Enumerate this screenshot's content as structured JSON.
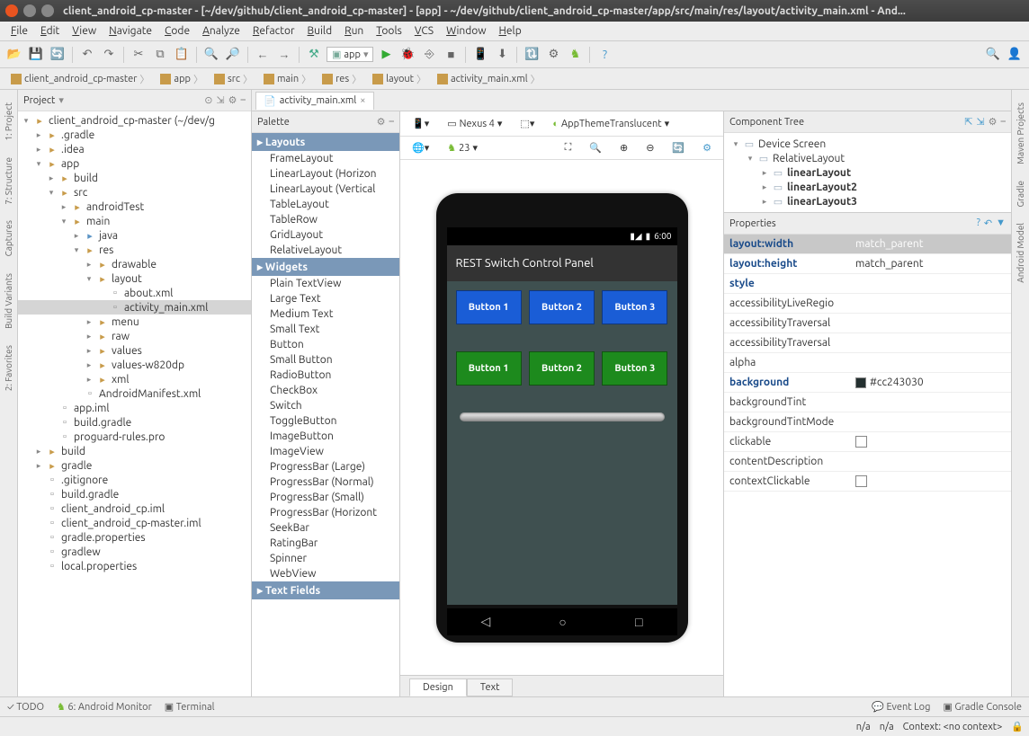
{
  "window": {
    "title": "client_android_cp-master - [~/dev/github/client_android_cp-master] - [app] - ~/dev/github/client_android_cp-master/app/src/main/res/layout/activity_main.xml - And..."
  },
  "menu": [
    "File",
    "Edit",
    "View",
    "Navigate",
    "Code",
    "Analyze",
    "Refactor",
    "Build",
    "Run",
    "Tools",
    "VCS",
    "Window",
    "Help"
  ],
  "toolbar": {
    "run_config": "app"
  },
  "breadcrumbs": [
    "client_android_cp-master",
    "app",
    "src",
    "main",
    "res",
    "layout",
    "activity_main.xml"
  ],
  "left_rail": [
    "1: Project",
    "7: Structure",
    "Captures"
  ],
  "left_rail2": [
    "Build Variants",
    "2: Favorites"
  ],
  "right_rail_top": [
    "Maven Projects",
    "Gradle"
  ],
  "right_rail_bottom": [
    "Android Model"
  ],
  "project_panel": {
    "title": "Project"
  },
  "tree": [
    {
      "d": 0,
      "a": "▾",
      "i": "folder-c",
      "t": "client_android_cp-master",
      "suffix": " (~/dev/g"
    },
    {
      "d": 1,
      "a": "▸",
      "i": "folder-c",
      "t": ".gradle"
    },
    {
      "d": 1,
      "a": "▸",
      "i": "folder-c",
      "t": ".idea"
    },
    {
      "d": 1,
      "a": "▾",
      "i": "folder-c",
      "t": "app"
    },
    {
      "d": 2,
      "a": "▸",
      "i": "folder-c",
      "t": "build"
    },
    {
      "d": 2,
      "a": "▾",
      "i": "folder-c",
      "t": "src"
    },
    {
      "d": 3,
      "a": "▸",
      "i": "folder-c",
      "t": "androidTest"
    },
    {
      "d": 3,
      "a": "▾",
      "i": "folder-c",
      "t": "main"
    },
    {
      "d": 4,
      "a": "▸",
      "i": "folder-b",
      "t": "java"
    },
    {
      "d": 4,
      "a": "▾",
      "i": "folder-c",
      "t": "res"
    },
    {
      "d": 5,
      "a": "▸",
      "i": "folder-c",
      "t": "drawable"
    },
    {
      "d": 5,
      "a": "▾",
      "i": "folder-c",
      "t": "layout"
    },
    {
      "d": 6,
      "a": "",
      "i": "file-x",
      "t": "about.xml"
    },
    {
      "d": 6,
      "a": "",
      "i": "file-x",
      "t": "activity_main.xml",
      "sel": true
    },
    {
      "d": 5,
      "a": "▸",
      "i": "folder-c",
      "t": "menu"
    },
    {
      "d": 5,
      "a": "▸",
      "i": "folder-c",
      "t": "raw"
    },
    {
      "d": 5,
      "a": "▸",
      "i": "folder-c",
      "t": "values"
    },
    {
      "d": 5,
      "a": "▸",
      "i": "folder-c",
      "t": "values-w820dp"
    },
    {
      "d": 5,
      "a": "▸",
      "i": "folder-c",
      "t": "xml"
    },
    {
      "d": 4,
      "a": "",
      "i": "file-x",
      "t": "AndroidManifest.xml"
    },
    {
      "d": 2,
      "a": "",
      "i": "file-x",
      "t": "app.iml"
    },
    {
      "d": 2,
      "a": "",
      "i": "file-x",
      "t": "build.gradle"
    },
    {
      "d": 2,
      "a": "",
      "i": "file-x",
      "t": "proguard-rules.pro"
    },
    {
      "d": 1,
      "a": "▸",
      "i": "folder-c",
      "t": "build"
    },
    {
      "d": 1,
      "a": "▸",
      "i": "folder-c",
      "t": "gradle"
    },
    {
      "d": 1,
      "a": "",
      "i": "file-x",
      "t": ".gitignore"
    },
    {
      "d": 1,
      "a": "",
      "i": "file-x",
      "t": "build.gradle"
    },
    {
      "d": 1,
      "a": "",
      "i": "file-x",
      "t": "client_android_cp.iml"
    },
    {
      "d": 1,
      "a": "",
      "i": "file-x",
      "t": "client_android_cp-master.iml"
    },
    {
      "d": 1,
      "a": "",
      "i": "file-x",
      "t": "gradle.properties"
    },
    {
      "d": 1,
      "a": "",
      "i": "file-x",
      "t": "gradlew"
    },
    {
      "d": 1,
      "a": "",
      "i": "file-x",
      "t": "local.properties"
    }
  ],
  "editor_tab": "activity_main.xml",
  "palette": {
    "title": "Palette",
    "group_layouts": "Layouts",
    "layouts": [
      "FrameLayout",
      "LinearLayout (Horizon",
      "LinearLayout (Vertical",
      "TableLayout",
      "TableRow",
      "GridLayout",
      "RelativeLayout"
    ],
    "group_widgets": "Widgets",
    "widgets": [
      "Plain TextView",
      "Large Text",
      "Medium Text",
      "Small Text",
      "Button",
      "Small Button",
      "RadioButton",
      "CheckBox",
      "Switch",
      "ToggleButton",
      "ImageButton",
      "ImageView",
      "ProgressBar (Large)",
      "ProgressBar (Normal)",
      "ProgressBar (Small)",
      "ProgressBar (Horizont",
      "SeekBar",
      "RatingBar",
      "Spinner",
      "WebView"
    ],
    "group_textfields": "Text Fields"
  },
  "design_toolbar": {
    "device": "Nexus 4",
    "theme": "AppThemeTranslucent",
    "api": "23"
  },
  "phone": {
    "time": "6:00",
    "app_title": "REST Switch Control Panel",
    "row1": [
      "Button 1",
      "Button 2",
      "Button 3"
    ],
    "row2": [
      "Button 1",
      "Button 2",
      "Button 3"
    ]
  },
  "design_tabs": {
    "design": "Design",
    "text": "Text"
  },
  "component_tree": {
    "title": "Component Tree",
    "items": [
      {
        "d": 0,
        "a": "▾",
        "t": "Device Screen"
      },
      {
        "d": 1,
        "a": "▾",
        "t": "RelativeLayout"
      },
      {
        "d": 2,
        "a": "▸",
        "t": "linearLayout"
      },
      {
        "d": 2,
        "a": "▸",
        "t": "linearLayout2"
      },
      {
        "d": 2,
        "a": "▸",
        "t": "linearLayout3"
      }
    ]
  },
  "properties": {
    "title": "Properties",
    "rows": [
      {
        "label": "layout:width",
        "value": "match_parent",
        "bold": true,
        "sel": true
      },
      {
        "label": "layout:height",
        "value": "match_parent",
        "bold": true
      },
      {
        "label": "style",
        "value": "",
        "bold": true
      },
      {
        "label": "accessibilityLiveRegio",
        "value": ""
      },
      {
        "label": "accessibilityTraversal",
        "value": ""
      },
      {
        "label": "accessibilityTraversal",
        "value": ""
      },
      {
        "label": "alpha",
        "value": ""
      },
      {
        "label": "background",
        "value": "#cc243030",
        "bold": true,
        "color": "#243030"
      },
      {
        "label": "backgroundTint",
        "value": ""
      },
      {
        "label": "backgroundTintMode",
        "value": ""
      },
      {
        "label": "clickable",
        "value": "",
        "checkbox": true
      },
      {
        "label": "contentDescription",
        "value": ""
      },
      {
        "label": "contextClickable",
        "value": "",
        "checkbox": true
      }
    ]
  },
  "bottom_tabs": {
    "todo": "TODO",
    "android": "6: Android Monitor",
    "terminal": "Terminal",
    "eventlog": "Event Log",
    "gradle": "Gradle Console"
  },
  "status": {
    "left": "",
    "na1": "n/a",
    "na2": "n/a",
    "context": "Context: <no context>"
  }
}
